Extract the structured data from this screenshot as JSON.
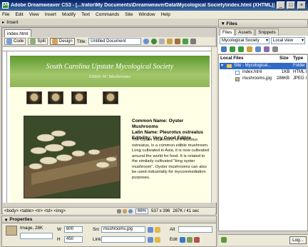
{
  "window": {
    "title": "Adobe Dreamweaver CS3 - [...trator\\My Documents\\DreamweaverData\\Mycological Society\\index.html (XHTML)]"
  },
  "menu": [
    "File",
    "Edit",
    "View",
    "Insert",
    "Modify",
    "Text",
    "Commands",
    "Site",
    "Window",
    "Help"
  ],
  "insert_bar": {
    "label": "Insert"
  },
  "document": {
    "tab": "index.html",
    "views": {
      "code": "Code",
      "split": "Split",
      "design": "Design"
    },
    "title_label": "Title:",
    "title_value": "Untitled Document"
  },
  "page": {
    "heading": "South Carolina Upstate Mycological Society",
    "subheading": "Edible SC Mushrooms",
    "info_lines": [
      "Common Name: Oyster Mushrooms",
      "Latin Name: Pleurotus ostreatus",
      "Edibility: Very Good Edible"
    ],
    "body_text": "The Oyster mushroom, or Pleurotus ostreatus, is a common edible mushroom. Long cultivated in Asia, it is now cultivated around the world for food. It is related to the similarly cultivated \"king oyster mushroom\". Oyster mushrooms can also be used industrially for mycoremediation purposes."
  },
  "status_bar": {
    "tags": "<body> <table> <tr> <td> <img>",
    "zoom": "66%",
    "size": "537 x 396",
    "weight": "287K / 41 sec"
  },
  "properties": {
    "title": "Properties",
    "image_label": "Image, 28K",
    "w_label": "W",
    "w_value": "800",
    "h_label": "H",
    "h_value": "450",
    "src_label": "Src",
    "src_value": "mushrooms.jpg",
    "link_label": "Link",
    "alt_label": "Alt",
    "edit_label": "Edit"
  },
  "files_panel": {
    "title": "Files",
    "tabs": [
      "Files",
      "Assets",
      "Snippets"
    ],
    "site_select": "Mycological Society",
    "view_select": "Local view",
    "columns": [
      "Local Files",
      "Size",
      "Type"
    ],
    "rows": [
      {
        "name": "Site - Mycological...",
        "size": "",
        "type": "Folder"
      },
      {
        "name": "index.html",
        "size": "1KB",
        "type": "HTML Do"
      },
      {
        "name": "mushrooms.jpg",
        "size": "286KB",
        "type": "JPEG Im..."
      }
    ],
    "log_button": "Log..."
  },
  "colors": {
    "title_bar": "#0a246a",
    "site_header": "#5d9a2e",
    "selection": "#316ac5",
    "page_bg": "#ffffe5"
  }
}
